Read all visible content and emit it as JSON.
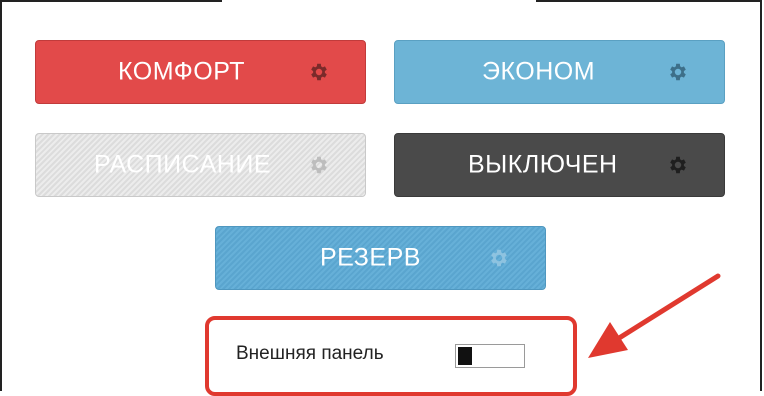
{
  "colors": {
    "comfort": "#e24a4a",
    "econom": "#6db4d6",
    "schedule": "#dcdcdc",
    "off": "#4a4a4a",
    "reserve": "#5aa5cf",
    "highlight": "#e0392f"
  },
  "modes": [
    {
      "label": "КОМФОРТ",
      "icon": "gear-icon"
    },
    {
      "label": "ЭКОНОМ",
      "icon": "gear-icon"
    },
    {
      "label": "РАСПИСАНИЕ",
      "icon": "gear-icon"
    },
    {
      "label": "ВЫКЛЮЧЕН",
      "icon": "gear-icon"
    },
    {
      "label": "РЕЗЕРВ",
      "icon": "gear-icon"
    }
  ],
  "external_panel": {
    "label": "Внешняя панель",
    "toggle_state": "off"
  }
}
